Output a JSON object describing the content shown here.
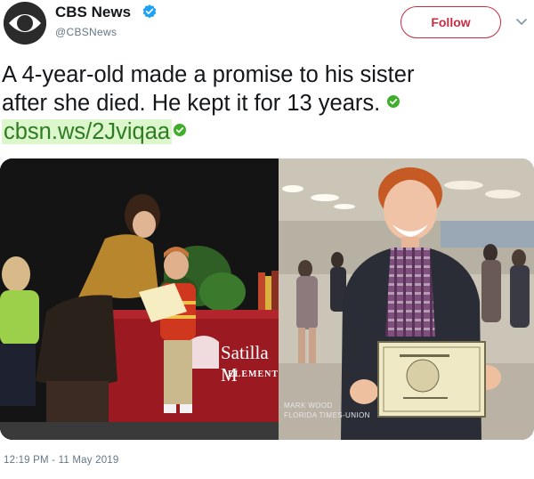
{
  "header": {
    "author_name": "CBS News",
    "author_handle": "@CBSNews",
    "follow_label": "Follow"
  },
  "tweet": {
    "text_line1": "A 4-year-old made a promise to his sister",
    "text_line2": "after she died. He kept it for 13 years.",
    "link": "cbsn.ws/2Jviqaa"
  },
  "media": {
    "left_photo": {
      "sign_line1": "Satilla M",
      "sign_line2": "ELEMENT"
    },
    "right_photo": {
      "credit_line1": "MARK WOOD",
      "credit_line2": "FLORIDA TIMES-UNION"
    }
  },
  "timestamp": "12:19 PM - 11 May 2019",
  "colors": {
    "follow_accent": "#c82c41",
    "link_bg": "#ddf7cc",
    "link_text": "#2e7b23",
    "handle_gray": "#657786",
    "verified_blue": "#1da1f2",
    "check_green": "#3fae2a"
  },
  "icons": {
    "avatar": "cbs-eye-logo",
    "verified": "verified-badge-icon",
    "menu": "chevron-down-icon",
    "emoji": "check-mark-icon"
  }
}
